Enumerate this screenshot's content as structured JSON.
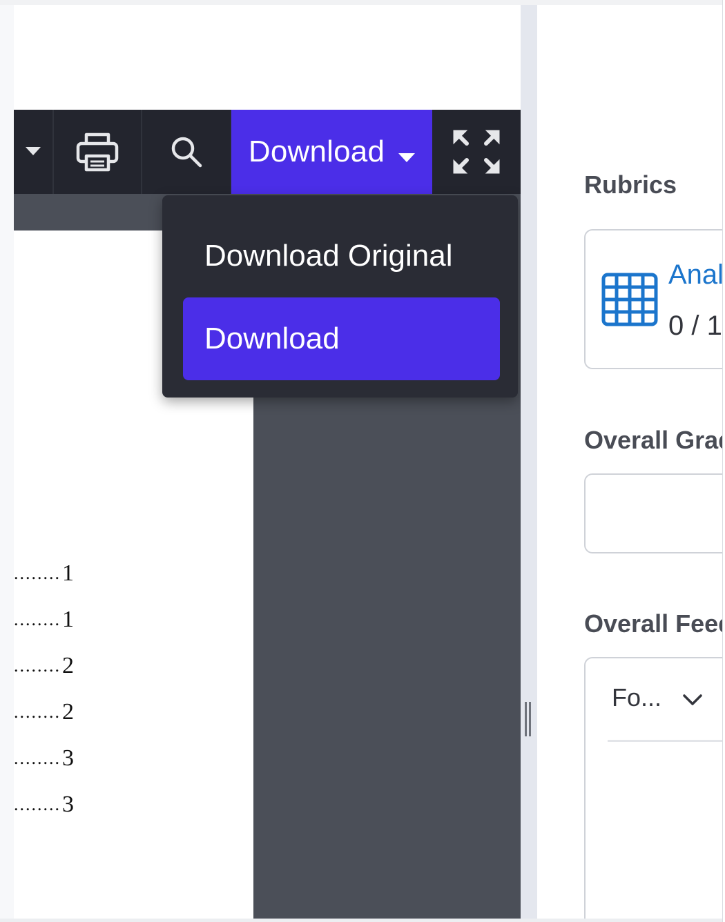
{
  "toolbar": {
    "download_label": "Download",
    "icons": [
      "dropdown-caret-icon",
      "printer-icon",
      "search-icon",
      "expand-icon"
    ]
  },
  "download_menu": {
    "items": [
      {
        "label": "Download Original",
        "active": false
      },
      {
        "label": "Download",
        "active": true
      }
    ]
  },
  "document": {
    "toc_lines": [
      {
        "dots": "........",
        "page": "1"
      },
      {
        "dots": "........",
        "page": "1"
      },
      {
        "dots": "........",
        "page": "2"
      },
      {
        "dots": "........",
        "page": "2"
      },
      {
        "dots": "........",
        "page": "3"
      },
      {
        "dots": "........",
        "page": "3"
      }
    ]
  },
  "grading_panel": {
    "rubrics_title": "Rubrics",
    "rubric": {
      "name": "Anal",
      "score": "0 / 1",
      "icon": "grid-icon"
    },
    "overall_grade_title": "Overall Grade",
    "overall_feedback_title": "Overall Feedback",
    "format_select_value": "Fo..."
  },
  "colors": {
    "accent": "#4b2ee8",
    "toolbar_bg": "#23252e",
    "menu_bg": "#2a2c35",
    "link": "#1b75cc"
  }
}
